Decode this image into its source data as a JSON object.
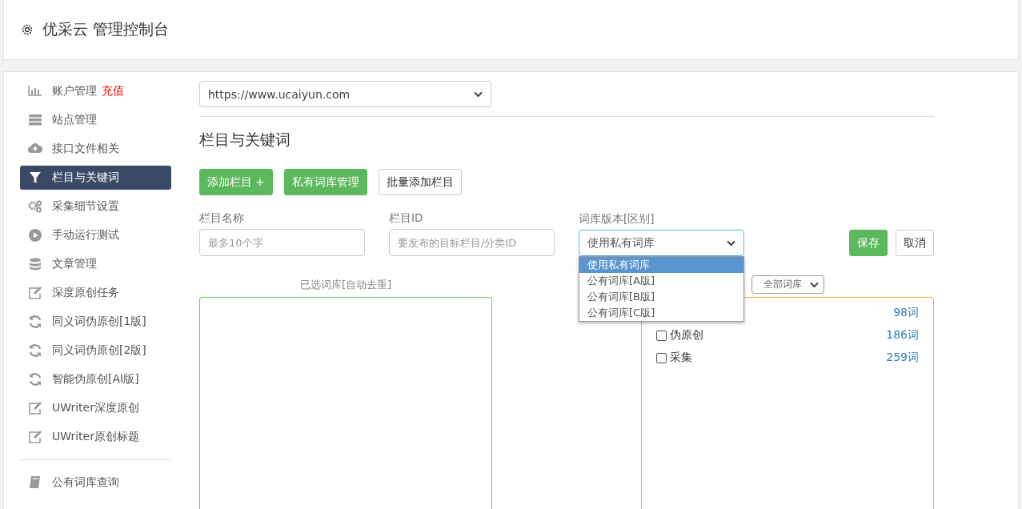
{
  "header": {
    "title": "优采云 管理控制台"
  },
  "sidebar": {
    "sections": [
      [
        {
          "label": "账户管理",
          "badge": "充值",
          "selected": false
        },
        {
          "label": "站点管理",
          "selected": false
        },
        {
          "label": "接口文件相关",
          "selected": false
        },
        {
          "label": "栏目与关键词",
          "selected": true
        },
        {
          "label": "采集细节设置",
          "selected": false
        },
        {
          "label": "手动运行测试",
          "selected": false
        },
        {
          "label": "文章管理",
          "selected": false
        },
        {
          "label": "深度原创任务",
          "selected": false
        },
        {
          "label": "同义词伪原创[1版]",
          "selected": false
        },
        {
          "label": "同义词伪原创[2版]",
          "selected": false
        },
        {
          "label": "智能伪原创[AI版]",
          "selected": false
        },
        {
          "label": "UWriter深度原创",
          "selected": false
        },
        {
          "label": "UWriter原创标题",
          "selected": false
        }
      ],
      [
        {
          "label": "公有词库查询",
          "selected": false
        }
      ]
    ]
  },
  "site_select": {
    "value": "https://www.ucaiyun.com"
  },
  "heading": "栏目与关键词",
  "buttons": [
    {
      "label": "添加栏目 +",
      "kind": "primary"
    },
    {
      "label": "私有词库管理",
      "kind": "primary"
    },
    {
      "label": "批量添加栏目",
      "kind": "default"
    }
  ],
  "form": {
    "fields": [
      {
        "label": "栏目名称",
        "placeholder": "最多10个字"
      },
      {
        "label": "栏目ID",
        "placeholder": "要发布的目标栏目/分类ID"
      }
    ],
    "lexicon_select": {
      "label": "词库版本[区别]",
      "value": "使用私有词库",
      "expanded": true,
      "options": [
        {
          "label": "使用私有词库",
          "selected": true
        },
        {
          "label": "公有词库[A版]",
          "selected": false
        },
        {
          "label": "公有词库[B版]",
          "selected": false
        },
        {
          "label": "公有词库[C版]",
          "selected": false
        }
      ]
    },
    "save": "保存",
    "cancel": "取消"
  },
  "selected_panel": {
    "label": "已选词库[自动去重]"
  },
  "library_panel": {
    "filter": "全部词库",
    "items": [
      {
        "count": "98词"
      },
      {
        "label": "伪原创",
        "count": "186词",
        "checked": false
      },
      {
        "label": "采集",
        "count": "259词",
        "checked": false
      }
    ]
  }
}
